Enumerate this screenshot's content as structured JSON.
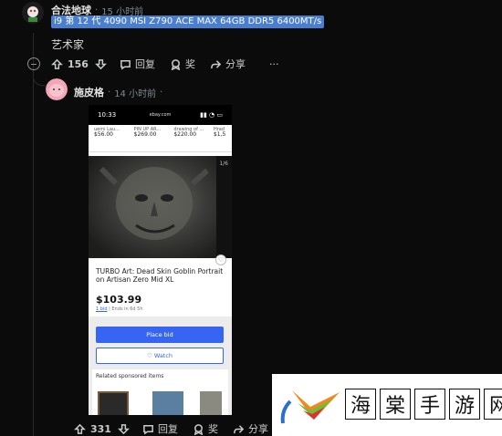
{
  "comment1": {
    "author": "合法地球",
    "time": "15 小时前",
    "flair": "i9 第 12 代 4090 MSI Z790 ACE MAX 64GB DDR5 6400MT/s",
    "body": "艺术家",
    "votes": "156",
    "reply_label": "回复",
    "award_label": "奖",
    "share_label": "分享",
    "more_label": "···"
  },
  "comment2": {
    "author": "施皮格",
    "time": "14 小时前",
    "votes": "331",
    "reply_label": "回复",
    "award_label": "奖",
    "share_label": "分享"
  },
  "embedded": {
    "status_time": "10:33",
    "url": "ebay.com",
    "sold": [
      {
        "name": "uemi Lau...",
        "price": "$56.00"
      },
      {
        "name": "PIN UP AR...",
        "price": "$269.00"
      },
      {
        "name": "drawing of ...",
        "price": "$220.00"
      },
      {
        "name": "Hrad",
        "price": "$1,5"
      }
    ],
    "image_counter": "1/6",
    "title": "TURBO Art: Dead Skin Goblin Portrait on Artisan Zero Mid XL",
    "price": "$103.99",
    "bids_link": "1 bid",
    "bids_rest": " | Ends in 6d 5h",
    "place_bid": "Place bid",
    "watch": "♡ Watch",
    "related": "Related sponsored items"
  },
  "watermark": {
    "chars": [
      "海",
      "棠",
      "手",
      "游",
      "网"
    ]
  },
  "colors": {
    "background": "#0b0b0b",
    "flair_bg": "#4a7fd0",
    "ebay_blue": "#3665f3"
  }
}
